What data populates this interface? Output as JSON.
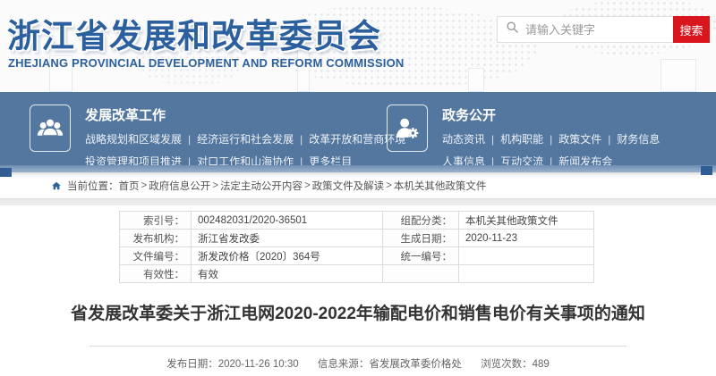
{
  "colors": {
    "brand_blue": "#2c5f9e",
    "nav_bg": "#54779f",
    "search_red": "#d9151d",
    "page_bg": "#ececec"
  },
  "icons": {
    "search": "magnifier-icon",
    "nav_section_1": "people-group-icon",
    "nav_section_2": "person-gear-icon",
    "breadcrumb": "home-icon"
  },
  "header": {
    "site_title_cn": "浙江省发展和改革委员会",
    "site_title_en": "ZHEJIANG PROVINCIAL DEVELOPMENT AND REFORM COMMISSION",
    "search": {
      "placeholder": "请输入关键字",
      "button_label": "搜索"
    }
  },
  "nav": {
    "separator": "|",
    "sections": [
      {
        "title": "发展改革工作",
        "rows": [
          [
            "战略规划和区域发展",
            "经济运行和社会发展",
            "改革开放和营商环境"
          ],
          [
            "投资管理和项目推进",
            "对口工作和山海协作",
            "更多栏目"
          ]
        ]
      },
      {
        "title": "政务公开",
        "rows": [
          [
            "动态资讯",
            "机构职能",
            "政策文件",
            "财务信息"
          ],
          [
            "人事信息",
            "互动交流",
            "新闻发布会"
          ]
        ]
      }
    ]
  },
  "breadcrumb": {
    "prefix": "当前位置：",
    "separator": ">",
    "items": [
      "首页",
      "政府信息公开",
      "法定主动公开内容",
      "政策文件及解读",
      "本机关其他政策文件"
    ]
  },
  "meta": {
    "rows": [
      {
        "l1": "索引号：",
        "v1": "002482031/2020-36501",
        "l2": "组配分类：",
        "v2": "本机关其他政策文件"
      },
      {
        "l1": "发布机构：",
        "v1": "浙江省发改委",
        "l2": "生成日期：",
        "v2": "2020-11-23"
      },
      {
        "l1": "文件编号：",
        "v1": "浙发改价格〔2020〕364号",
        "l2": "统一编号：",
        "v2": ""
      },
      {
        "l1": "有效性：",
        "v1": "有效",
        "l2": "",
        "v2": ""
      }
    ]
  },
  "doc": {
    "title": "省发展改革委关于浙江电网2020-2022年输配电价和销售电价有关事项的通知",
    "publish": {
      "date_label": "发布日期：",
      "date": "2020-11-26 10:30",
      "source_label": "信息来源：",
      "source": "省发展改革委价格处",
      "views_label": "浏览次数：",
      "views": "489"
    }
  }
}
